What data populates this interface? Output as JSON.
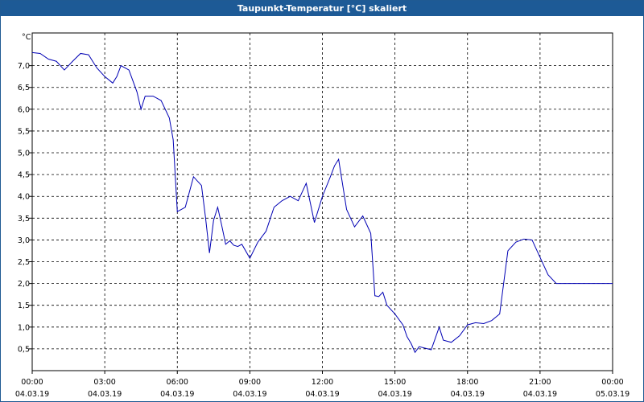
{
  "window": {
    "title": "Taupunkt-Temperatur [°C] skaliert"
  },
  "chart_data": {
    "type": "line",
    "title": "Taupunkt-Temperatur [°C] skaliert",
    "ylabel": "°C",
    "xlabel": "",
    "ylim": [
      0,
      7.75
    ],
    "grid": true,
    "y_ticks": [
      "0,5",
      "1,0",
      "1,5",
      "2,0",
      "2,5",
      "3,0",
      "3,5",
      "4,0",
      "4,5",
      "5,0",
      "5,5",
      "6,0",
      "6,5",
      "7,0"
    ],
    "y_tick_values": [
      0.5,
      1.0,
      1.5,
      2.0,
      2.5,
      3.0,
      3.5,
      4.0,
      4.5,
      5.0,
      5.5,
      6.0,
      6.5,
      7.0
    ],
    "x_ticks": [
      {
        "time": "00:00",
        "date": "04.03.19"
      },
      {
        "time": "03:00",
        "date": "04.03.19"
      },
      {
        "time": "06:00",
        "date": "04.03.19"
      },
      {
        "time": "09:00",
        "date": "04.03.19"
      },
      {
        "time": "12:00",
        "date": "04.03.19"
      },
      {
        "time": "15:00",
        "date": "04.03.19"
      },
      {
        "time": "18:00",
        "date": "04.03.19"
      },
      {
        "time": "21:00",
        "date": "04.03.19"
      },
      {
        "time": "00:00",
        "date": "05.03.19"
      }
    ],
    "x_range": [
      "04.03.19 00:00",
      "05.03.19 00:00"
    ],
    "series": [
      {
        "color": "#0000b4",
        "x": [
          0,
          0.33,
          0.67,
          1,
          1.33,
          1.67,
          2,
          2.33,
          2.67,
          3,
          3.33,
          3.5,
          3.67,
          4,
          4.33,
          4.5,
          4.67,
          5,
          5.33,
          5.67,
          5.83,
          6,
          6.33,
          6.67,
          7,
          7.17,
          7.33,
          7.5,
          7.67,
          7.83,
          8,
          8.17,
          8.33,
          8.5,
          8.67,
          9,
          9.33,
          9.67,
          10,
          10.33,
          10.67,
          11,
          11.33,
          11.67,
          12,
          12.33,
          12.5,
          12.67,
          13,
          13.33,
          13.67,
          14,
          14.17,
          14.33,
          14.5,
          14.67,
          15,
          15.33,
          15.5,
          15.67,
          15.83,
          16,
          16.5,
          16.83,
          17,
          17.33,
          17.67,
          18,
          18.33,
          18.67,
          19,
          19.33,
          19.67,
          20,
          20.33,
          20.67,
          21,
          21.33,
          21.67,
          22,
          22.33,
          22.67,
          23,
          23.33,
          23.67,
          24
        ],
        "y": [
          7.3,
          7.28,
          7.15,
          7.1,
          6.9,
          7.1,
          7.28,
          7.25,
          6.95,
          6.75,
          6.6,
          6.75,
          7.0,
          6.9,
          6.4,
          6.0,
          6.3,
          6.3,
          6.2,
          5.8,
          5.3,
          3.65,
          3.75,
          4.45,
          4.25,
          3.5,
          2.7,
          3.45,
          3.75,
          3.35,
          2.9,
          2.98,
          2.88,
          2.85,
          2.9,
          2.58,
          2.95,
          3.2,
          3.75,
          3.9,
          4.0,
          3.9,
          4.3,
          3.4,
          4.0,
          4.45,
          4.7,
          4.85,
          3.7,
          3.3,
          3.55,
          3.15,
          1.72,
          1.7,
          1.8,
          1.5,
          1.3,
          1.05,
          0.78,
          0.62,
          0.42,
          0.55,
          0.48,
          1.0,
          0.7,
          0.65,
          0.8,
          1.05,
          1.1,
          1.08,
          1.15,
          1.3,
          2.75,
          2.95,
          3.02,
          3.0,
          2.6,
          2.2,
          2.0,
          2.0,
          2.0,
          2.0,
          2.0,
          2.0,
          2.0,
          2.0
        ]
      }
    ]
  }
}
